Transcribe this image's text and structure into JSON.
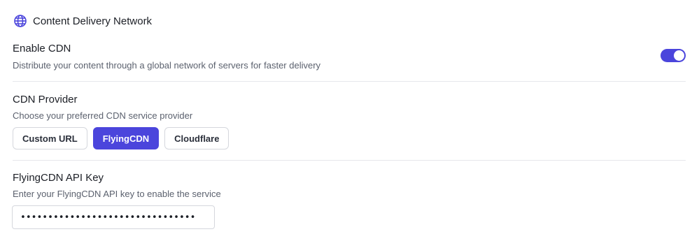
{
  "section": {
    "title": "Content Delivery Network",
    "icon": "globe-icon",
    "accent_color": "#4b45dc"
  },
  "enable_cdn": {
    "label": "Enable CDN",
    "description": "Distribute your content through a global network of servers for faster delivery",
    "enabled": true
  },
  "provider": {
    "label": "CDN Provider",
    "description": "Choose your preferred CDN service provider",
    "options": [
      "Custom URL",
      "FlyingCDN",
      "Cloudflare"
    ],
    "selected": "FlyingCDN"
  },
  "api_key": {
    "label": "FlyingCDN API Key",
    "description": "Enter your FlyingCDN API key to enable the service",
    "value": "••••••••••••••••••••••••••••••••"
  }
}
